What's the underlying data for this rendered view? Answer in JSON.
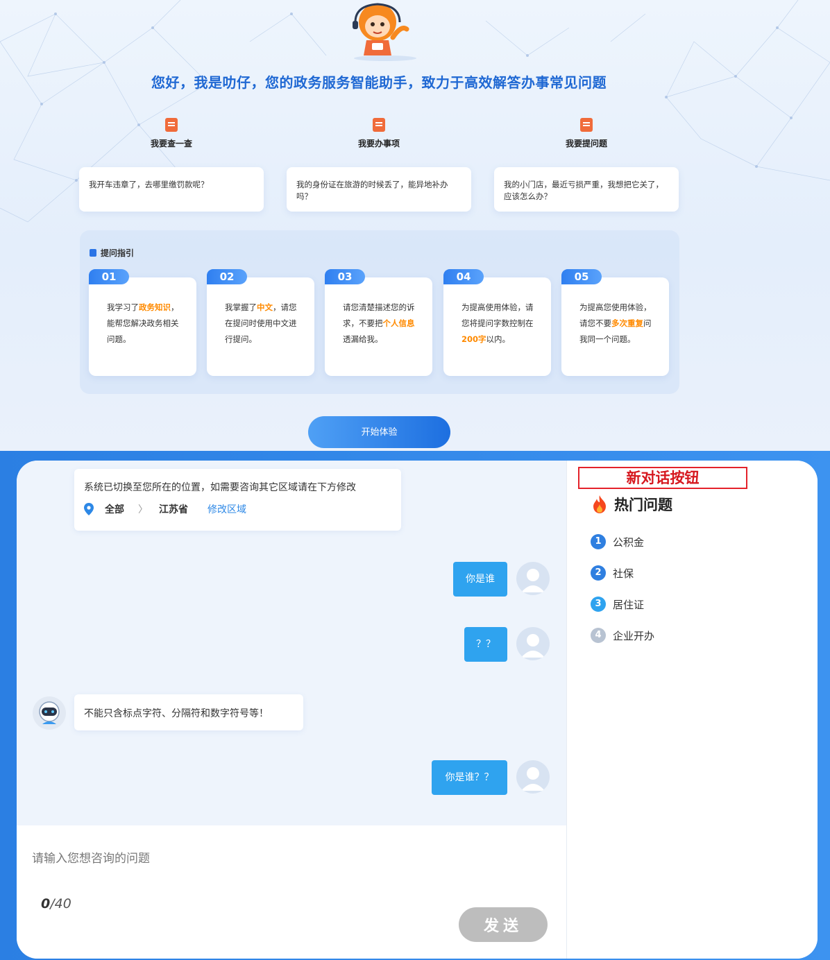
{
  "intro": {
    "headline": "您好，我是叻仔，您的政务服务智能助手，致力于高效解答办事常见问题",
    "categories": [
      {
        "title": "我要查一查",
        "example": "我开车违章了，去哪里缴罚款呢？",
        "icon": "book-icon",
        "color": "#f06b3a"
      },
      {
        "title": "我要办事项",
        "example": "我的身份证在旅游的时候丢了，能异地补办吗？",
        "icon": "document-edit-icon",
        "color": "#f06b3a"
      },
      {
        "title": "我要提问题",
        "example": "我的小门店，最近亏损严重，我想把它关了，应该怎么办？",
        "icon": "question-icon",
        "color": "#f06b3a"
      }
    ],
    "guide": {
      "title": "提问指引",
      "steps": [
        {
          "num": "01",
          "parts": [
            "我学习了",
            "政务知识",
            "，能帮您解决政务相关问题。"
          ]
        },
        {
          "num": "02",
          "parts": [
            "我掌握了",
            "中文",
            "，请您在提问时使用中文进行提问。"
          ]
        },
        {
          "num": "03",
          "parts": [
            "请您清楚描述您的诉求，不要把",
            "个人信息",
            "透漏给我。"
          ]
        },
        {
          "num": "04",
          "parts": [
            "为提高使用体验，请您将提问字数控制在",
            "200字",
            "以内。"
          ]
        },
        {
          "num": "05",
          "parts": [
            "为提高您使用体验，请您不要",
            "多次重复",
            "问我同一个问题。"
          ]
        }
      ]
    },
    "start_button": "开始体验"
  },
  "chat": {
    "system_message": "系统已切换至您所在的位置，如需要咨询其它区域请在下方修改",
    "location": {
      "all": "全部",
      "separator": "〉",
      "province": "江苏省",
      "edit_link": "修改区域"
    },
    "messages": [
      {
        "role": "user",
        "text": "你是谁"
      },
      {
        "role": "user",
        "text": "？？"
      },
      {
        "role": "bot",
        "text": "不能只含标点字符、分隔符和数字符号等！"
      },
      {
        "role": "user",
        "text": "你是谁？？"
      }
    ],
    "input": {
      "placeholder": "请输入您想咨询的问题",
      "value": "",
      "count": "0",
      "max": "/40"
    },
    "send_button": "发送"
  },
  "sidebar": {
    "new_chat_button": "新对话按钮",
    "hot_title": "热门问题",
    "hot_items": [
      {
        "num": "1",
        "label": "公积金",
        "color": "#2f7fe0"
      },
      {
        "num": "2",
        "label": "社保",
        "color": "#2f7fe0"
      },
      {
        "num": "3",
        "label": "居住证",
        "color": "#2fa3ef"
      },
      {
        "num": "4",
        "label": "企业开办",
        "color": "#b8c3d2"
      }
    ]
  }
}
